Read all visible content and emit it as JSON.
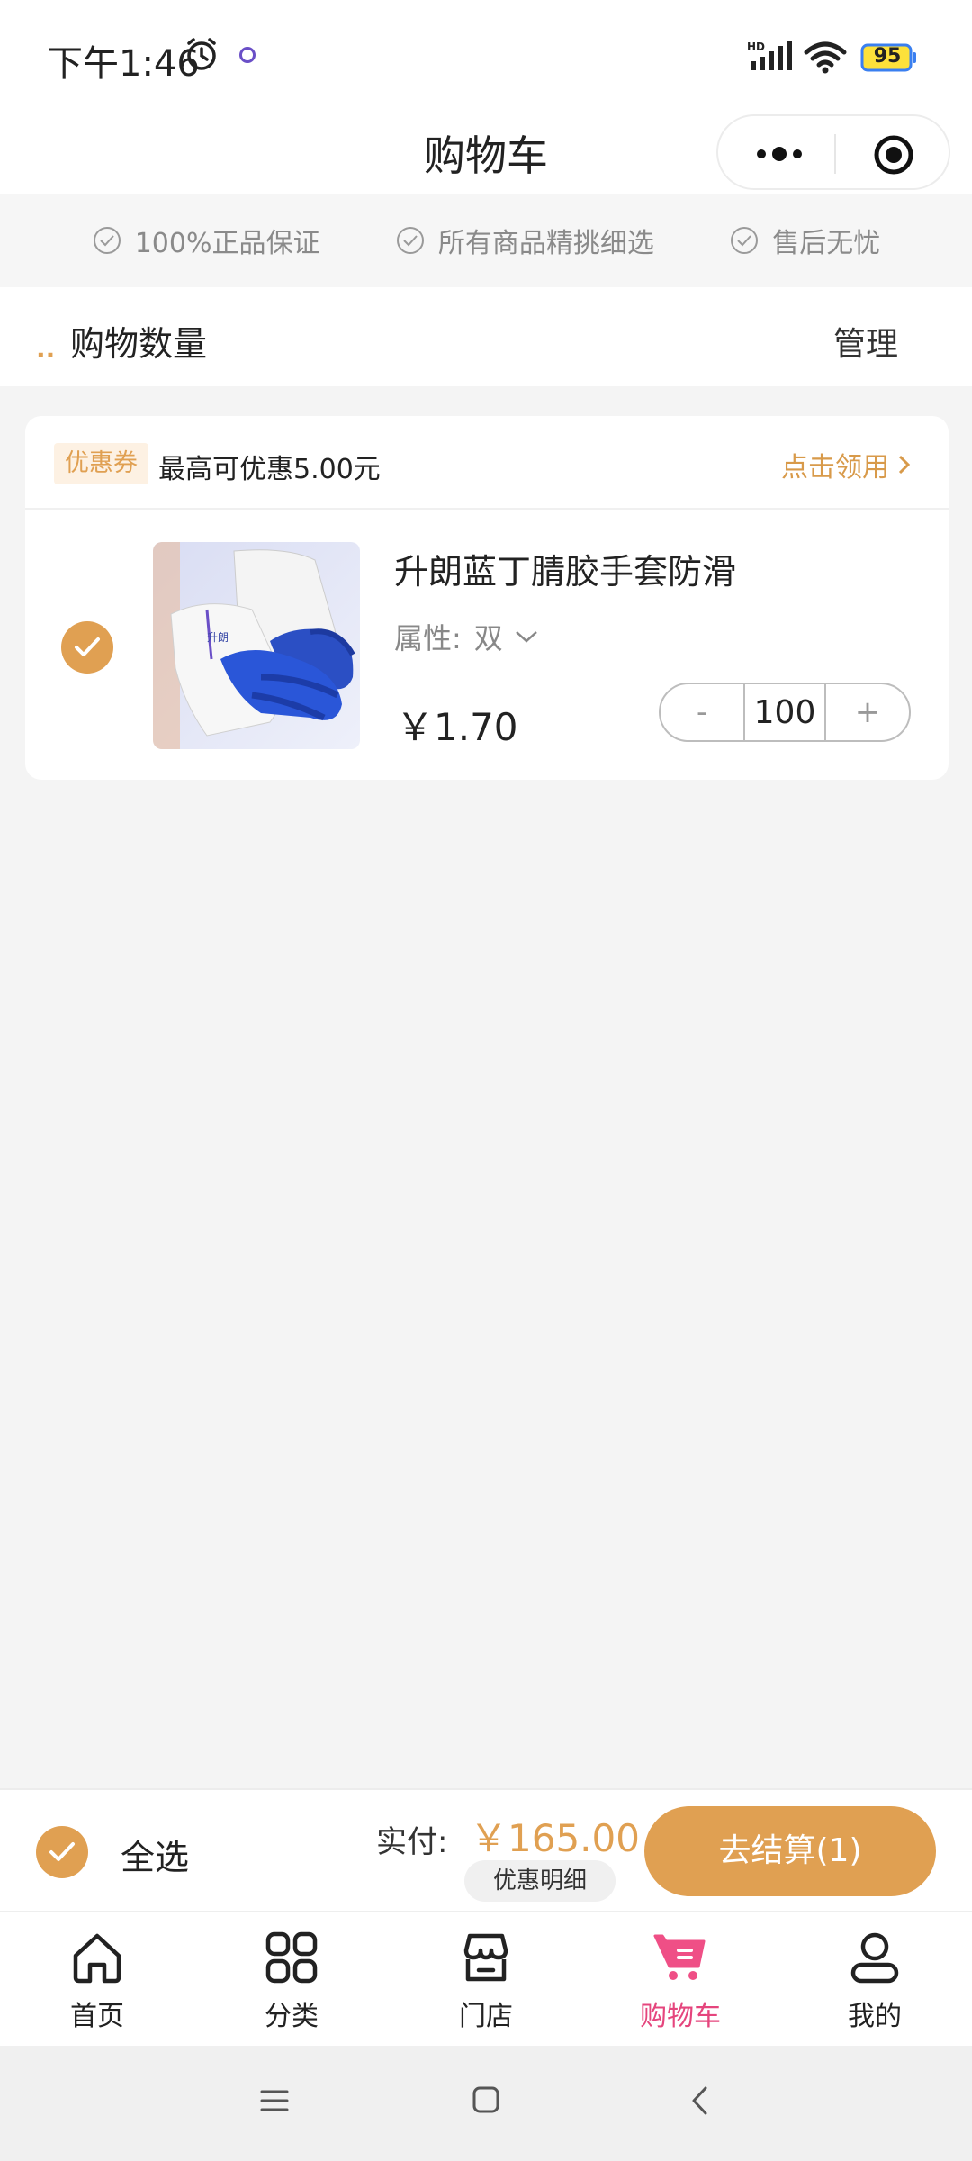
{
  "status_bar": {
    "time": "下午1:46",
    "battery": "95",
    "network": "HD"
  },
  "header": {
    "title": "购物车"
  },
  "guarantees": [
    {
      "icon": "check-circle-icon",
      "label": "100%正品保证"
    },
    {
      "icon": "check-circle-icon",
      "label": "所有商品精挑细选"
    },
    {
      "icon": "check-circle-icon",
      "label": "售后无忧"
    }
  ],
  "cart": {
    "count_label": "购物数量",
    "manage_label": "管理"
  },
  "coupon": {
    "tag": "优惠券",
    "text": "最高可优惠5.00元",
    "action": "点击领用"
  },
  "item": {
    "selected": true,
    "name": "升朗蓝丁腈胶手套防滑",
    "attr_label": "属性:",
    "attr_value": "双",
    "price": "￥1.70",
    "quantity": "100",
    "minus_label": "-",
    "plus_label": "+"
  },
  "checkout": {
    "select_all_label": "全选",
    "pay_label": "实付:",
    "amount": "￥165.00",
    "discount_detail_label": "优惠明细",
    "checkout_label": "去结算(1)"
  },
  "tabbar": [
    {
      "icon": "home-icon",
      "label": "首页",
      "active": false
    },
    {
      "icon": "grid-icon",
      "label": "分类",
      "active": false
    },
    {
      "icon": "store-icon",
      "label": "门店",
      "active": false
    },
    {
      "icon": "cart-icon",
      "label": "购物车",
      "active": true
    },
    {
      "icon": "user-icon",
      "label": "我的",
      "active": false
    }
  ],
  "colors": {
    "accent": "#e0a052",
    "tab_active": "#e5457d"
  }
}
